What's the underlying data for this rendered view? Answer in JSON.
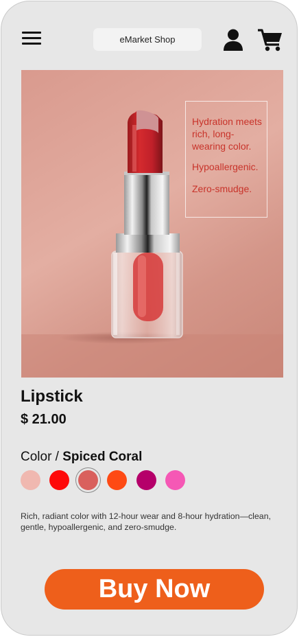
{
  "header": {
    "title": "eMarket Shop",
    "menu_icon": "hamburger-menu-icon",
    "account_icon": "user-icon",
    "cart_icon": "shopping-cart-icon"
  },
  "image": {
    "claims": [
      "Hydration meets rich, long-wearing color.",
      "Hypoallergenic.",
      "Zero-smudge."
    ]
  },
  "product": {
    "name": "Lipstick",
    "price": "$ 21.00",
    "color_label": "Color / ",
    "selected_color": "Spiced Coral",
    "swatches": [
      {
        "color": "#f0b8b0",
        "selected": false
      },
      {
        "color": "#fe0a0a",
        "selected": false
      },
      {
        "color": "#d9605d",
        "selected": true
      },
      {
        "color": "#fe4a14",
        "selected": false
      },
      {
        "color": "#b5006a",
        "selected": false
      },
      {
        "color": "#f558b5",
        "selected": false
      }
    ],
    "description": "Rich, radiant color with 12-hour wear and 8-hour hydration—clean, gentle, hypoallergenic, and zero-smudge."
  },
  "actions": {
    "buy_label": "Buy Now"
  },
  "colors": {
    "background": "#e7e7e7",
    "accent": "#ee5f1b",
    "claim_text": "#c8332a"
  }
}
